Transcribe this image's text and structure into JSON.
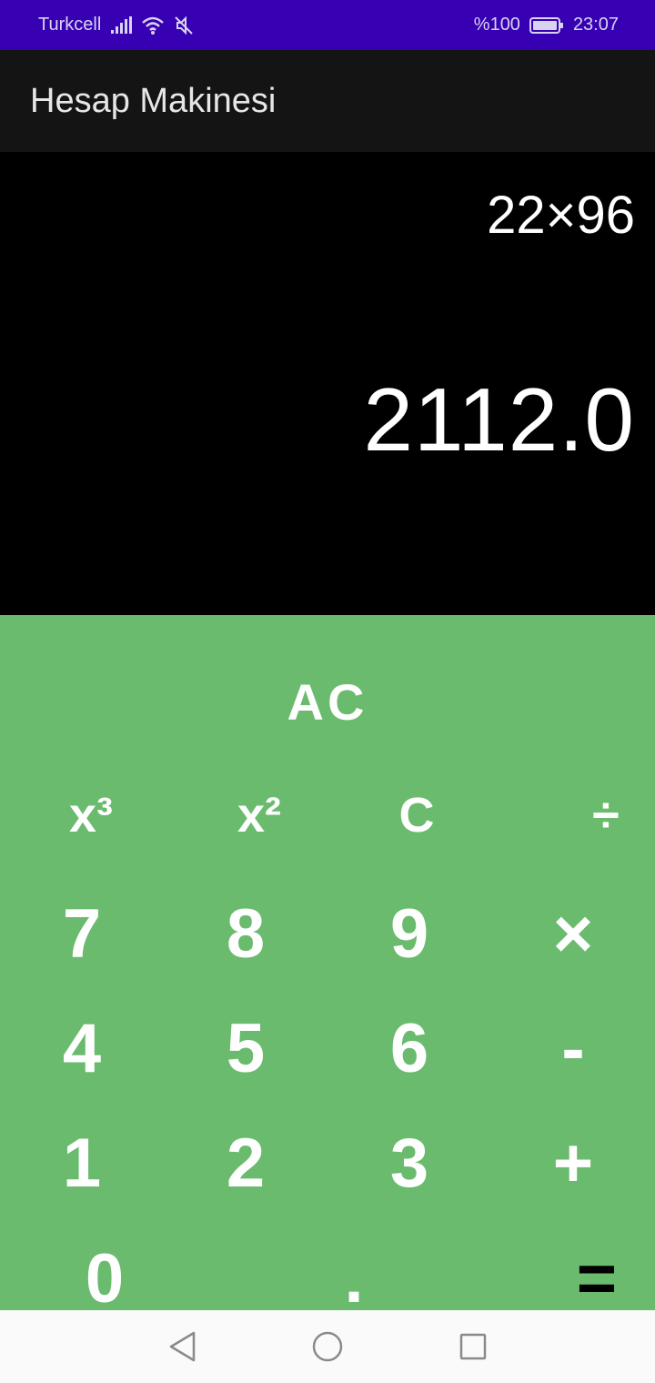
{
  "status_bar": {
    "carrier": "Turkcell",
    "battery_text": "%100",
    "time": "23:07",
    "icons": [
      "signal-icon",
      "wifi-icon",
      "mute-icon",
      "battery-icon"
    ],
    "battery_level": 1.0
  },
  "app": {
    "title": "Hesap Makinesi"
  },
  "display": {
    "expression": "22×96",
    "result": "2112.0"
  },
  "keypad": {
    "background": "#6abb6e",
    "ac": "AC",
    "row1": [
      "x³",
      "x²",
      "C",
      "÷"
    ],
    "row2": [
      "7",
      "8",
      "9",
      "×"
    ],
    "row3": [
      "4",
      "5",
      "6",
      "-"
    ],
    "row4": [
      "1",
      "2",
      "3",
      "+"
    ],
    "row5": [
      "0",
      ".",
      "="
    ]
  },
  "nav_bar": {
    "icons": [
      "back-icon",
      "home-icon",
      "recents-icon"
    ]
  }
}
